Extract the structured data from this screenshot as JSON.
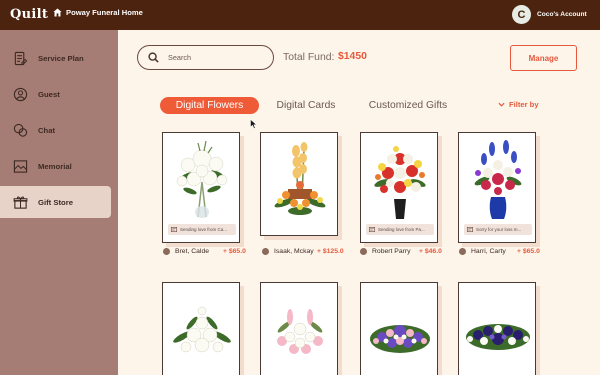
{
  "topbar": {
    "logo": "Quilt",
    "funeral_home": "Poway Funeral Home",
    "avatar_letter": "C",
    "account_name": "Coco's Account"
  },
  "sidebar": {
    "items": [
      {
        "label": "Service Plan",
        "icon": "service-plan-icon"
      },
      {
        "label": "Guest",
        "icon": "guest-icon"
      },
      {
        "label": "Chat",
        "icon": "chat-icon"
      },
      {
        "label": "Memorial",
        "icon": "memorial-icon"
      },
      {
        "label": "Gift Store",
        "icon": "gift-icon",
        "active": true
      }
    ]
  },
  "toolbar": {
    "search_placeholder": "Search",
    "fund_label": "Total Fund:",
    "fund_value": "$1450",
    "manage_label": "Manage"
  },
  "tabs": [
    "Digital Flowers",
    "Digital Cards",
    "Customized Gifts"
  ],
  "filter_label": "Filter by",
  "cards": [
    {
      "message": "Sending love from Ca...",
      "sender": "Bret, Calde",
      "amount": "+ $65.0"
    },
    {
      "message": "",
      "sender": "Isaak, Mckay",
      "amount": "+ $125.0"
    },
    {
      "message": "Sending love from Pa...",
      "sender": "Robert Parry",
      "amount": "+ $46.0"
    },
    {
      "message": "Sorry for your loss m...",
      "sender": "Harri, Carty",
      "amount": "+ $65.0"
    }
  ],
  "colors": {
    "topbar": "#4b230f",
    "sidebar": "#a57d74",
    "accent": "#ef5a37",
    "background": "#fdf4ea"
  }
}
